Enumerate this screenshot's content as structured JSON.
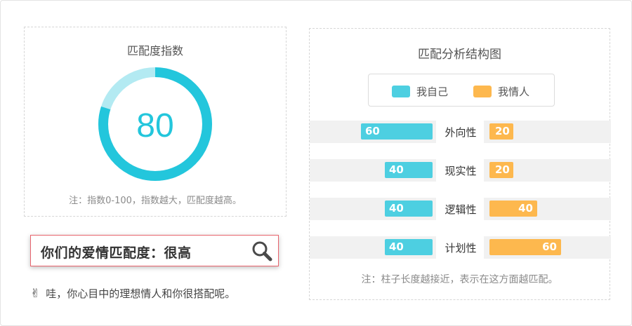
{
  "gauge": {
    "title": "匹配度指数",
    "value": "80",
    "fraction": 0.8,
    "note": "注：指数0-100，指数越大，匹配度越高。",
    "colors": {
      "fill": "#23c6dc",
      "track": "#b3eaf2",
      "text": "#23c6dc"
    }
  },
  "result": {
    "text": "你们的爱情匹配度：很高",
    "icon": "magnifier-icon"
  },
  "comment": {
    "icon": "victory-hand-icon",
    "text": "哇，你心目中的理想情人和你很搭配呢。"
  },
  "structure": {
    "title": "匹配分析结构图",
    "legend": [
      {
        "label": "我自己",
        "color": "#4dcfe1"
      },
      {
        "label": "我情人",
        "color": "#fdb84e"
      }
    ],
    "rows": [
      {
        "trait": "外向性",
        "self": "60",
        "partner": "20",
        "self_value": 60,
        "partner_value": 20
      },
      {
        "trait": "现实性",
        "self": "40",
        "partner": "20",
        "self_value": 40,
        "partner_value": 20
      },
      {
        "trait": "逻辑性",
        "self": "40",
        "partner": "40",
        "self_value": 40,
        "partner_value": 40
      },
      {
        "trait": "计划性",
        "self": "40",
        "partner": "60",
        "self_value": 40,
        "partner_value": 60
      }
    ],
    "note": "注：柱子长度越接近，表示在这方面越匹配。"
  }
}
